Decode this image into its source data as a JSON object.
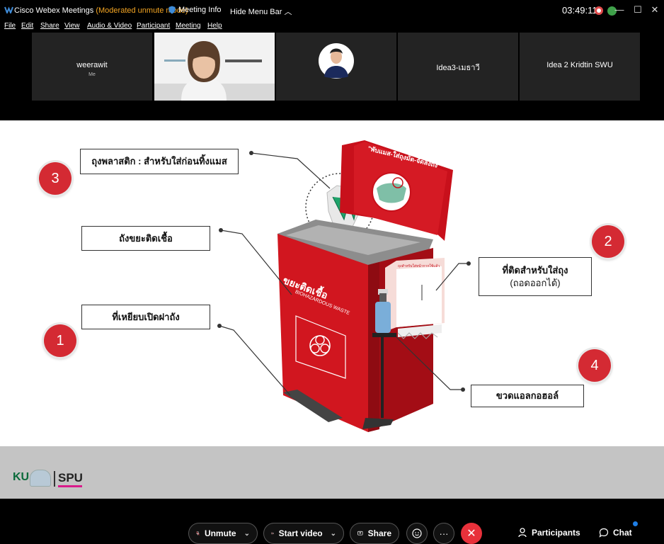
{
  "window": {
    "app_title": "Cisco Webex Meetings",
    "mode": "(Moderated unmute mode)",
    "meeting_info": "Meeting Info",
    "hide_menu_bar": "Hide Menu Bar",
    "time": "03:49:11",
    "accent_color": "#f5a623"
  },
  "menu": [
    "File",
    "Edit",
    "Share",
    "View",
    "Audio & Video",
    "Participant",
    "Meeting",
    "Help"
  ],
  "participants": [
    {
      "name": "weerawit",
      "sub": "Me"
    },
    {
      "name": "",
      "sub": ""
    },
    {
      "name": "",
      "sub": ""
    },
    {
      "name": "Idea3-เมธาวี",
      "sub": ""
    },
    {
      "name": "Idea 2 Kridtin SWU",
      "sub": ""
    }
  ],
  "slide": {
    "labels": {
      "bag": "ถุงพลาสติก : สำหรับใส่ก่อนทิ้งแมส",
      "bin": "ถังขยะติดเชื้อ",
      "pedal": "ที่เหยียบเปิดฝาถัง",
      "holder_line1": "ที่ติดสำหรับใส่ถุง",
      "holder_line2": "(ถอดออกได้)",
      "bottle": "ขวดแอลกอฮอล์"
    },
    "badges": [
      "1",
      "2",
      "3",
      "4"
    ],
    "bin_text": {
      "lid": "\"พับแมส-ใส่ถุงมัด-จัดลงถัง\"",
      "front_th": "ขยะติดเชื้อ",
      "front_en": "BIOHAZARDOUS WASTE",
      "holder_tag": "ถุงสำหรับใส่หน้ากากใช้แล้ว"
    },
    "bin_color": "#d1161f"
  },
  "footer": {
    "logo_ku": "KU",
    "logo_spu": "SPU"
  },
  "controls": {
    "unmute": "Unmute",
    "start_video": "Start video",
    "share": "Share",
    "participants": "Participants",
    "chat": "Chat",
    "more": "···"
  }
}
